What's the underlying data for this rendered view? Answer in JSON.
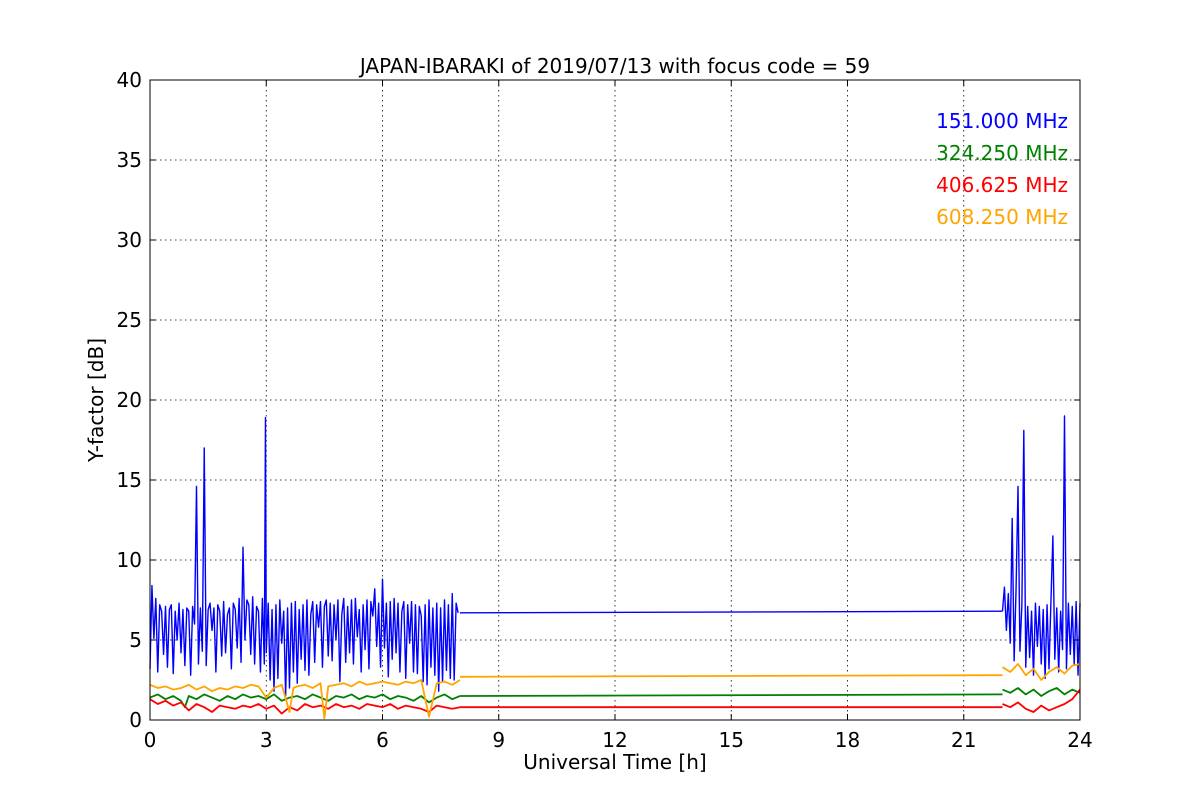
{
  "chart_data": {
    "type": "line",
    "title": "JAPAN-IBARAKI of 2019/07/13 with focus code = 59",
    "xlabel": "Universal Time [h]",
    "ylabel": "Y-factor [dB]",
    "xlim": [
      0,
      24
    ],
    "ylim": [
      0,
      40
    ],
    "xticks": [
      0,
      3,
      6,
      9,
      12,
      15,
      18,
      21,
      24
    ],
    "xtick_labels": [
      "0",
      "3",
      "6",
      "9",
      "12",
      "15",
      "18",
      "21",
      "24"
    ],
    "yticks": [
      0,
      5,
      10,
      15,
      20,
      25,
      30,
      35,
      40
    ],
    "ytick_labels": [
      "0",
      "5",
      "10",
      "15",
      "20",
      "25",
      "30",
      "35",
      "40"
    ],
    "grid": true,
    "legend_position": "top-right",
    "series": [
      {
        "name": "151.000 MHz",
        "color": "#0000ff",
        "segments": [
          {
            "x": [
              0.0,
              0.05,
              0.1,
              0.15,
              0.2,
              0.25,
              0.3,
              0.35,
              0.4,
              0.45,
              0.5,
              0.55,
              0.6,
              0.65,
              0.7,
              0.75,
              0.8,
              0.85,
              0.9,
              0.95,
              1.0,
              1.05,
              1.1,
              1.15,
              1.2,
              1.25,
              1.3,
              1.35,
              1.4,
              1.45,
              1.5,
              1.55,
              1.6,
              1.65,
              1.7,
              1.75,
              1.8,
              1.85,
              1.9,
              1.95,
              2.0,
              2.05,
              2.1,
              2.15,
              2.2,
              2.25,
              2.3,
              2.35,
              2.4,
              2.45,
              2.5,
              2.55,
              2.6,
              2.65,
              2.7,
              2.75,
              2.8,
              2.85,
              2.9,
              2.95,
              2.98,
              3.0,
              3.05,
              3.1,
              3.15,
              3.2,
              3.25,
              3.3,
              3.35,
              3.4,
              3.45,
              3.5,
              3.55,
              3.6,
              3.65,
              3.7,
              3.75,
              3.8,
              3.85,
              3.9,
              3.95,
              4.0,
              4.05,
              4.1,
              4.15,
              4.2,
              4.25,
              4.3,
              4.35,
              4.4,
              4.45,
              4.5,
              4.55,
              4.6,
              4.65,
              4.7,
              4.75,
              4.8,
              4.85,
              4.9,
              4.95,
              5.0,
              5.05,
              5.1,
              5.15,
              5.2,
              5.25,
              5.3,
              5.35,
              5.4,
              5.45,
              5.5,
              5.55,
              5.6,
              5.65,
              5.7,
              5.75,
              5.8,
              5.85,
              5.9,
              5.95,
              6.0,
              6.05,
              6.1,
              6.15,
              6.2,
              6.25,
              6.3,
              6.35,
              6.4,
              6.45,
              6.5,
              6.55,
              6.6,
              6.65,
              6.7,
              6.75,
              6.8,
              6.85,
              6.9,
              6.95,
              7.0,
              7.05,
              7.1,
              7.15,
              7.2,
              7.25,
              7.3,
              7.35,
              7.4,
              7.45,
              7.5,
              7.55,
              7.6,
              7.65,
              7.7,
              7.75,
              7.8,
              7.85,
              7.9,
              7.95,
              8.0
            ],
            "y": [
              3.2,
              8.4,
              5.1,
              7.6,
              3.0,
              7.2,
              6.8,
              4.1,
              7.1,
              3.3,
              6.9,
              7.2,
              2.9,
              6.8,
              5.0,
              7.3,
              4.2,
              6.9,
              3.4,
              7.0,
              6.8,
              2.8,
              7.1,
              6.0,
              14.6,
              3.5,
              7.0,
              4.3,
              17.0,
              3.4,
              6.9,
              7.3,
              5.6,
              7.0,
              3.0,
              7.2,
              6.8,
              4.0,
              7.4,
              4.2,
              6.6,
              7.0,
              3.2,
              7.3,
              6.9,
              4.5,
              7.6,
              3.6,
              10.8,
              5.0,
              7.5,
              7.2,
              4.1,
              7.7,
              3.5,
              7.1,
              6.8,
              3.0,
              7.6,
              3.5,
              18.9,
              4.2,
              7.3,
              2.5,
              6.9,
              1.8,
              7.2,
              2.6,
              7.5,
              4.8,
              6.8,
              1.5,
              7.0,
              2.0,
              7.3,
              3.0,
              7.4,
              2.3,
              6.9,
              3.8,
              7.2,
              3.1,
              7.5,
              2.8,
              6.6,
              7.4,
              3.6,
              7.2,
              5.8,
              7.4,
              3.3,
              7.1,
              7.5,
              4.0,
              7.3,
              3.7,
              7.2,
              5.0,
              7.5,
              2.4,
              6.6,
              7.6,
              3.6,
              7.1,
              4.2,
              7.5,
              3.5,
              7.6,
              5.2,
              6.9,
              3.0,
              7.2,
              4.4,
              7.5,
              3.2,
              7.4,
              6.5,
              8.2,
              4.6,
              7.3,
              3.3,
              8.8,
              4.5,
              7.3,
              2.7,
              7.4,
              3.8,
              7.6,
              4.2,
              7.3,
              3.0,
              6.8,
              7.4,
              2.6,
              7.2,
              4.8,
              7.4,
              3.0,
              7.2,
              2.9,
              7.1,
              6.5,
              2.4,
              7.2,
              2.2,
              7.5,
              3.3,
              7.0,
              2.8,
              7.3,
              1.8,
              7.0,
              2.4,
              7.5,
              3.1,
              7.2,
              2.6,
              7.9,
              2.5,
              7.3,
              6.7
            ]
          },
          {
            "x": [
              8.0,
              22.0
            ],
            "y": [
              6.7,
              6.8
            ]
          },
          {
            "x": [
              22.0,
              22.05,
              22.1,
              22.15,
              22.2,
              22.25,
              22.3,
              22.35,
              22.4,
              22.45,
              22.5,
              22.55,
              22.6,
              22.65,
              22.7,
              22.75,
              22.8,
              22.85,
              22.9,
              22.95,
              23.0,
              23.05,
              23.1,
              23.15,
              23.2,
              23.25,
              23.3,
              23.35,
              23.4,
              23.45,
              23.5,
              23.55,
              23.6,
              23.65,
              23.7,
              23.75,
              23.8,
              23.85,
              23.9,
              23.95,
              24.0
            ],
            "y": [
              6.8,
              8.3,
              5.6,
              7.9,
              4.8,
              12.6,
              3.7,
              8.2,
              14.6,
              4.3,
              7.2,
              18.1,
              3.3,
              7.1,
              3.9,
              6.8,
              2.8,
              7.3,
              4.6,
              7.1,
              3.5,
              6.9,
              2.6,
              7.2,
              3.2,
              7.4,
              11.5,
              3.8,
              7.0,
              3.0,
              6.8,
              4.4,
              19.0,
              3.2,
              7.3,
              4.1,
              7.1,
              3.5,
              7.4,
              2.8,
              7.3
            ]
          }
        ]
      },
      {
        "name": "324.250 MHz",
        "color": "#008000",
        "segments": [
          {
            "x": [
              0.0,
              0.2,
              0.4,
              0.6,
              0.8,
              0.9,
              1.0,
              1.2,
              1.4,
              1.6,
              1.8,
              2.0,
              2.2,
              2.4,
              2.6,
              2.8,
              3.0,
              3.2,
              3.4,
              3.6,
              3.8,
              4.0,
              4.2,
              4.4,
              4.6,
              4.8,
              5.0,
              5.2,
              5.4,
              5.6,
              5.8,
              6.0,
              6.2,
              6.4,
              6.6,
              6.8,
              7.0,
              7.2,
              7.4,
              7.6,
              7.8,
              8.0
            ],
            "y": [
              1.4,
              1.6,
              1.3,
              1.5,
              1.2,
              0.8,
              1.5,
              1.3,
              1.6,
              1.4,
              1.2,
              1.5,
              1.3,
              1.6,
              1.4,
              1.5,
              1.3,
              1.6,
              1.2,
              1.4,
              1.5,
              1.3,
              1.6,
              1.4,
              1.2,
              1.5,
              1.4,
              1.6,
              1.3,
              1.5,
              1.4,
              1.6,
              1.3,
              1.5,
              1.4,
              1.2,
              1.5,
              1.1,
              1.4,
              1.6,
              1.3,
              1.5
            ]
          },
          {
            "x": [
              8.0,
              22.0
            ],
            "y": [
              1.5,
              1.6
            ]
          },
          {
            "x": [
              22.0,
              22.2,
              22.4,
              22.6,
              22.8,
              23.0,
              23.2,
              23.4,
              23.6,
              23.8,
              24.0
            ],
            "y": [
              1.9,
              1.7,
              2.0,
              1.6,
              1.9,
              1.5,
              1.8,
              2.0,
              1.6,
              1.9,
              1.7
            ]
          }
        ]
      },
      {
        "name": "406.625 MHz",
        "color": "#ff0000",
        "segments": [
          {
            "x": [
              0.0,
              0.2,
              0.4,
              0.6,
              0.8,
              1.0,
              1.2,
              1.4,
              1.6,
              1.8,
              2.0,
              2.2,
              2.4,
              2.6,
              2.8,
              3.0,
              3.2,
              3.4,
              3.6,
              3.8,
              4.0,
              4.2,
              4.4,
              4.6,
              4.8,
              5.0,
              5.2,
              5.4,
              5.6,
              5.8,
              6.0,
              6.2,
              6.4,
              6.6,
              6.8,
              7.0,
              7.2,
              7.4,
              7.6,
              7.8,
              8.0
            ],
            "y": [
              1.3,
              1.0,
              1.2,
              0.9,
              1.1,
              0.6,
              1.0,
              0.8,
              0.5,
              0.9,
              0.8,
              0.7,
              0.9,
              0.8,
              1.0,
              0.7,
              0.9,
              0.4,
              0.8,
              0.6,
              1.0,
              0.8,
              0.9,
              0.7,
              1.0,
              0.8,
              0.9,
              0.7,
              1.0,
              0.9,
              0.8,
              1.0,
              0.7,
              0.9,
              0.8,
              0.7,
              0.5,
              0.9,
              0.8,
              0.7,
              0.8
            ]
          },
          {
            "x": [
              8.0,
              22.0
            ],
            "y": [
              0.8,
              0.8
            ]
          },
          {
            "x": [
              22.0,
              22.2,
              22.4,
              22.6,
              22.8,
              23.0,
              23.2,
              23.4,
              23.6,
              23.8,
              24.0
            ],
            "y": [
              1.0,
              0.8,
              1.1,
              0.7,
              0.5,
              0.9,
              0.6,
              0.8,
              1.0,
              1.3,
              1.9
            ]
          }
        ]
      },
      {
        "name": "608.250 MHz",
        "color": "#ffa500",
        "segments": [
          {
            "x": [
              0.0,
              0.2,
              0.4,
              0.6,
              0.8,
              1.0,
              1.2,
              1.4,
              1.6,
              1.8,
              2.0,
              2.2,
              2.4,
              2.6,
              2.8,
              3.0,
              3.2,
              3.4,
              3.6,
              3.7,
              3.8,
              4.0,
              4.2,
              4.4,
              4.5,
              4.6,
              4.8,
              5.0,
              5.2,
              5.4,
              5.6,
              5.8,
              6.0,
              6.2,
              6.4,
              6.6,
              6.8,
              7.0,
              7.2,
              7.4,
              7.6,
              7.8,
              8.0
            ],
            "y": [
              2.2,
              2.0,
              2.1,
              1.9,
              2.0,
              2.2,
              1.9,
              2.1,
              1.8,
              2.0,
              1.9,
              2.1,
              2.0,
              2.2,
              2.1,
              1.4,
              2.0,
              2.2,
              0.5,
              2.0,
              2.1,
              2.2,
              2.0,
              2.3,
              0.1,
              2.1,
              2.2,
              2.3,
              2.1,
              2.4,
              2.2,
              2.3,
              2.4,
              2.3,
              2.2,
              2.4,
              2.3,
              2.5,
              0.2,
              2.3,
              2.4,
              2.2,
              2.5
            ]
          },
          {
            "x": [
              8.0,
              22.0
            ],
            "y": [
              2.7,
              2.8
            ]
          },
          {
            "x": [
              22.0,
              22.2,
              22.4,
              22.6,
              22.8,
              23.0,
              23.2,
              23.4,
              23.6,
              23.8,
              24.0
            ],
            "y": [
              3.3,
              3.0,
              3.5,
              2.8,
              3.2,
              2.5,
              3.0,
              3.3,
              2.9,
              3.4,
              3.5
            ]
          }
        ]
      }
    ]
  }
}
